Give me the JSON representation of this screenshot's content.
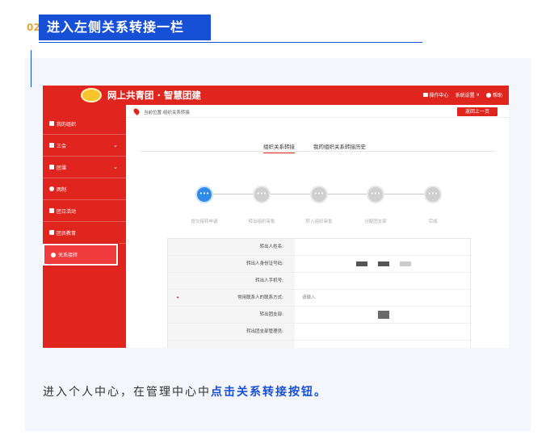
{
  "header": {
    "step_number": "02",
    "step_title": "进入左侧关系转接一栏"
  },
  "topbar": {
    "brand": "网上共青团 · 智慧团建",
    "operations_center": "操作中心",
    "system_settings": "系统设置",
    "help": "帮助"
  },
  "sidebar": {
    "items": [
      {
        "label": "我的组织",
        "expandable": false
      },
      {
        "label": "三会",
        "expandable": true
      },
      {
        "label": "团课",
        "expandable": true
      },
      {
        "label": "两制",
        "expandable": false
      },
      {
        "label": "团日活动",
        "expandable": false
      },
      {
        "label": "团员教育",
        "expandable": false
      },
      {
        "label": "关系接转",
        "expandable": false,
        "active": true
      }
    ]
  },
  "content": {
    "location": "当前位置:组织关系转接",
    "back_button": "返回上一页",
    "tabs": [
      "组织关系转接",
      "我的组织关系转接历史"
    ],
    "active_tab": 0,
    "progress_steps": [
      {
        "icon": "•••",
        "label": "提交接转申请",
        "active": true
      },
      {
        "icon": "•••",
        "label": "转出组织审批",
        "active": false
      },
      {
        "icon": "•••",
        "label": "转入组织审批",
        "active": false
      },
      {
        "icon": "•••",
        "label": "分配团支部",
        "active": false
      },
      {
        "icon": "•••",
        "label": "完成",
        "active": false
      }
    ],
    "form_rows": [
      {
        "label": "转出人姓名:",
        "value": "",
        "required": false
      },
      {
        "label": "转出人身份证号码:",
        "value": "",
        "required": false
      },
      {
        "label": "转出人手机号:",
        "value": "",
        "required": false
      },
      {
        "label": "常用联系人的联系方式:",
        "value": "请输入",
        "required": true
      },
      {
        "label": "转出团支部:",
        "value": "",
        "required": false
      },
      {
        "label": "转出团支部管理员:",
        "value": "",
        "required": false
      }
    ]
  },
  "description": {
    "prefix": "进入个人中心，在管理中心中",
    "highlight": "点击关系转接按钮。"
  },
  "colors": {
    "brand_red": "#e0251f",
    "accent_blue": "#1650d6",
    "step_active": "#2f8be6",
    "step_number": "#e8a33a"
  }
}
